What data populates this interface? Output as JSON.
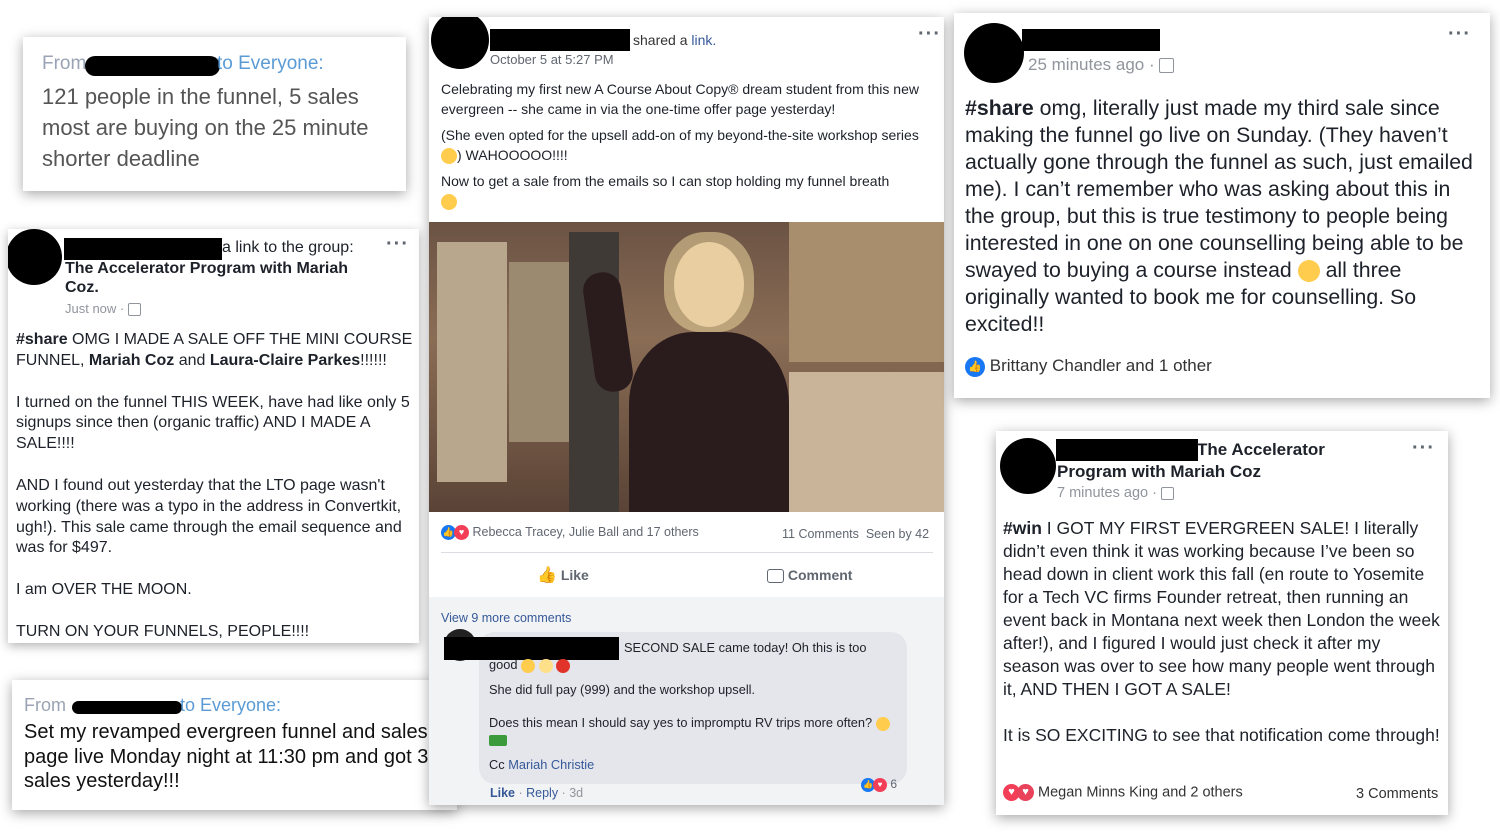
{
  "chat1": {
    "from_label": "From",
    "to_label": "to Everyone:",
    "lines": [
      "121 people in the funnel, 5 sales",
      "most are buying on the 25 minute",
      "shorter deadline"
    ]
  },
  "post1": {
    "header_suffix": "a link to the group:",
    "group_name": "The Accelerator Program with Mariah",
    "group_name2": "Coz",
    "time": "Just now",
    "p1_tag": "#share",
    "p1_a": " OMG I MADE A SALE OFF THE MINI COURSE FUNNEL, ",
    "p1_name1": "Mariah Coz",
    "p1_b": " and ",
    "p1_name2": "Laura-Claire Parkes",
    "p1_c": "!!!!!!",
    "p2": "I turned on the funnel THIS WEEK, have had like only 5 signups since then (organic traffic) AND I MADE A SALE!!!!",
    "p3": "AND I found out yesterday that the LTO page wasn't working (there was a typo in the address in Convertkit, ugh!). This sale came through the email sequence and was for $497.",
    "p4": "I am OVER THE MOON.",
    "p5": "TURN ON YOUR FUNNELS, PEOPLE!!!!"
  },
  "chat2": {
    "from_label": "From",
    "to_label": "to Everyone:",
    "text": "Set my revamped evergreen funnel and sales page live Monday night at 11:30 pm and got 3 sales yesterday!!!"
  },
  "post2": {
    "shared_text": "shared a",
    "link_text": "link.",
    "time": "October 5 at 5:27 PM",
    "p1": "Celebrating my first new A Course About Copy® dream student from this new evergreen -- she came in via the one-time offer page yesterday!",
    "p2a": "(She even opted for the upsell add-on of my beyond-the-site workshop series ",
    "p2b": ") WAHOOOOO!!!!",
    "p3": "Now to get a sale from the emails so I can stop holding my funnel breath",
    "reactions": "Rebecca Tracey, Julie Ball and 17 others",
    "comments": "11 Comments",
    "seen": "Seen by 42",
    "like": "Like",
    "comment": "Comment",
    "view_more": "View 9 more comments",
    "c_line1": "SECOND SALE came today! Oh this is too",
    "c_line2": "good",
    "c_p2": "She did full pay (999) and the workshop upsell.",
    "c_p3": "Does this mean I should say yes to impromptu RV trips more often?",
    "c_cc": "Cc",
    "c_name": "Mariah Christie",
    "c_like": "Like",
    "c_reply": "Reply",
    "c_time": "3d",
    "c_count": "6"
  },
  "post3": {
    "time": "25 minutes ago",
    "tag": "#share",
    "text": " omg, literally just made my third sale since making the funnel go live on Sunday. (They haven’t actually gone through the funnel as such, just emailed me). I can’t remember who was asking about this in the group, but this is true testimony to people being interested in one on one counselling being able to be swayed to buying a course instead ",
    "text2": " all three originally wanted to book me for counselling. So excited!!",
    "reactions": "Brittany Chandler and 1 other"
  },
  "post4": {
    "group1": "The Accelerator",
    "group2": "Program with Mariah Coz",
    "time": "7 minutes ago",
    "tag": "#win",
    "p1": " I GOT MY FIRST EVERGREEN SALE! I literally didn’t even think it was working because I’ve been so head down in client work this fall (en route to Yosemite for a Tech VC firms Founder retreat, then running an event back in Montana next week then London the week after!), and I figured I would just check it after my season was over to see how many people went through it, AND THEN I GOT A SALE!",
    "p2": "It is SO EXCITING to see that notification come through!",
    "reactions": "Megan Minns King and 2 others",
    "comments": "3 Comments"
  },
  "icons": {
    "like": "thumbs-up-icon",
    "love": "heart-icon",
    "comment": "speech-bubble-icon",
    "privacy": "group-icon",
    "menu": "more-dots-icon"
  },
  "colors": {
    "fb_blue": "#365899",
    "like_blue": "#1877f2",
    "love_red": "#f33e58",
    "zoom_blue": "#5b9bd5"
  }
}
